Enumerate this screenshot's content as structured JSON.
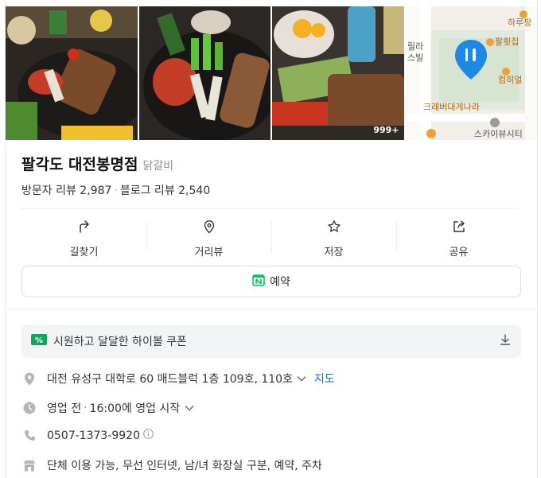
{
  "photos": {
    "count_badge": "999+"
  },
  "map": {
    "labels": [
      "하루팡",
      "팔횟집",
      "릴라",
      "스빌",
      "컴히얼",
      "크래버대게나라",
      "스카이뷰시티"
    ]
  },
  "place": {
    "name": "팔각도 대전봉명점",
    "category": "닭갈비",
    "visitor_reviews": "방문자 리뷰 2,987",
    "separator": "·",
    "blog_reviews": "블로그 리뷰 2,540"
  },
  "actions": [
    {
      "label": "길찾기",
      "icon": "directions-icon"
    },
    {
      "label": "거리뷰",
      "icon": "location-pin-icon"
    },
    {
      "label": "저장",
      "icon": "star-icon"
    },
    {
      "label": "공유",
      "icon": "share-icon"
    }
  ],
  "reserve": {
    "label": "예약",
    "icon": "naver-booking-icon",
    "color": "#03c75a"
  },
  "coupon": {
    "text": "시원하고 달달한 하이볼 쿠폰"
  },
  "info": {
    "address": "대전 유성구 대학로 60 매드블럭 1층 109호, 110호",
    "map_link": "지도",
    "hours_status": "영업 전",
    "hours_sep": "·",
    "hours_detail": "16:00에 영업 시작",
    "phone": "0507-1373-9920",
    "amenities": "단체 이용 가능, 무선 인터넷, 남/녀 화장실 구분, 예약, 주차"
  },
  "colors": {
    "link": "#1a66d9",
    "map_pin": "#1e88e5"
  }
}
